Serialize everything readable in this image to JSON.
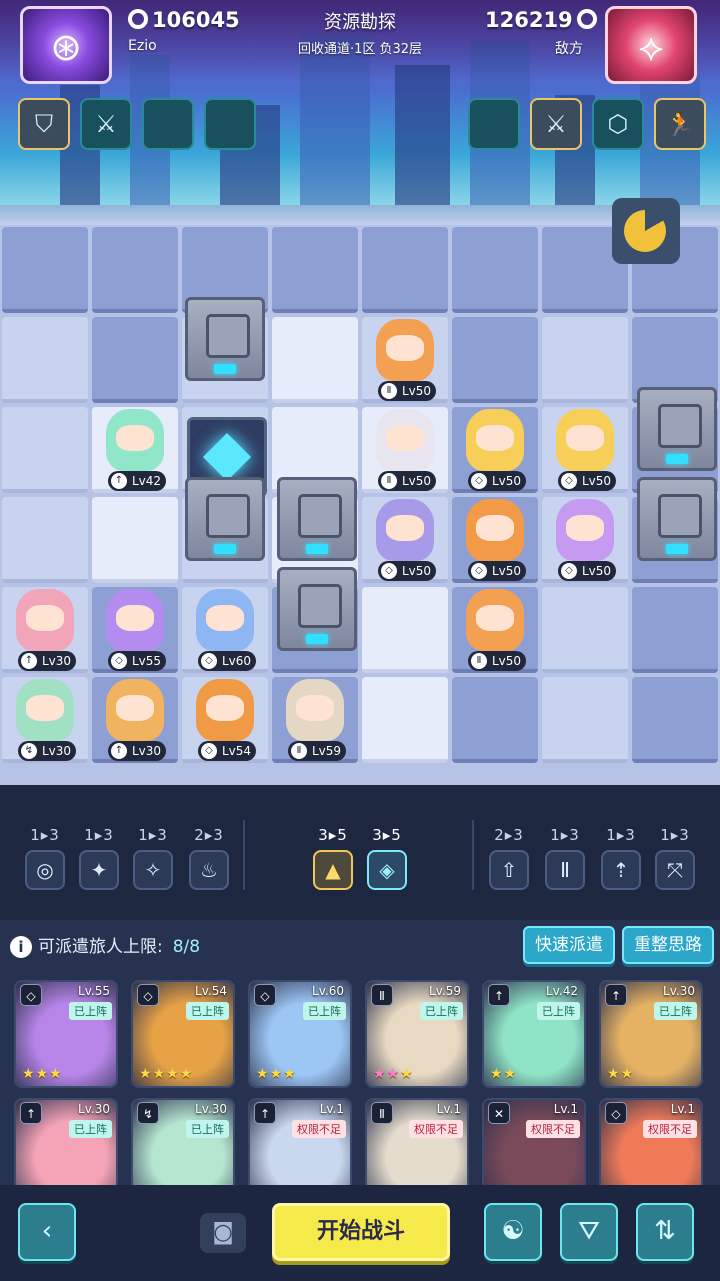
{
  "header": {
    "title": "资源勘探",
    "subtitle": "回收通道·1区 负32层",
    "player": {
      "name": "Ezio",
      "resource": "106045",
      "avatar_icon": "purple-emblem-icon"
    },
    "enemy": {
      "name": "敌方",
      "resource": "126219",
      "avatar_icon": "red-emblem-icon"
    },
    "player_slots": [
      "shield-emblem-icon",
      "sword-icon",
      "empty-slot",
      "empty-slot"
    ],
    "enemy_slots": [
      "empty-slot",
      "sword-icon",
      "hexagon-icon",
      "running-man-icon"
    ]
  },
  "board": {
    "units": [
      {
        "lv": "Lv42",
        "cls": "↑",
        "color": "#8fe6c9"
      },
      {
        "lv": "Lv30",
        "cls": "↑",
        "color": "#f2a4b8"
      },
      {
        "lv": "Lv55",
        "cls": "◇",
        "color": "#b48cf0"
      },
      {
        "lv": "Lv60",
        "cls": "◇",
        "color": "#8db6f3"
      },
      {
        "lv": "Lv30",
        "cls": "↯",
        "color": "#a2e0c4"
      },
      {
        "lv": "Lv30",
        "cls": "↑",
        "color": "#f2b361"
      },
      {
        "lv": "Lv54",
        "cls": "◇",
        "color": "#f09a45"
      },
      {
        "lv": "Lv59",
        "cls": "Ⅱ",
        "color": "#e4d7c4"
      },
      {
        "lv": "Lv50",
        "cls": "Ⅱ",
        "color": "#f3a053"
      },
      {
        "lv": "Lv50",
        "cls": "Ⅱ",
        "color": "#e8e4f0"
      },
      {
        "lv": "Lv50",
        "cls": "◇",
        "color": "#a79ae8"
      },
      {
        "lv": "Lv50",
        "cls": "◇",
        "color": "#f7cf58"
      },
      {
        "lv": "Lv50",
        "cls": "◇",
        "color": "#f7cf58"
      },
      {
        "lv": "Lv50",
        "cls": "◇",
        "color": "#f39a48"
      },
      {
        "lv": "Lv50",
        "cls": "◇",
        "color": "#c59af0"
      },
      {
        "lv": "Lv50",
        "cls": "Ⅱ",
        "color": "#f3a053"
      }
    ],
    "corner_icon": "pacman-icon"
  },
  "synergy": {
    "left": [
      {
        "count": "1▸3",
        "icon": "swirl-icon",
        "glyph": "◎"
      },
      {
        "count": "1▸3",
        "icon": "shuriken-icon",
        "glyph": "✦"
      },
      {
        "count": "1▸3",
        "icon": "dagger-icon",
        "glyph": "✧"
      },
      {
        "count": "2▸3",
        "icon": "flame-icon",
        "glyph": "♨"
      }
    ],
    "active": [
      {
        "count": "3▸5",
        "icon": "mountain-icon",
        "glyph": "▲"
      },
      {
        "count": "3▸5",
        "icon": "diamond-icon",
        "glyph": "◈"
      }
    ],
    "right": [
      {
        "count": "2▸3",
        "icon": "arrow-up-icon",
        "glyph": "⇧"
      },
      {
        "count": "1▸3",
        "icon": "gate-icon",
        "glyph": "Ⅱ"
      },
      {
        "count": "1▸3",
        "icon": "spear-icon",
        "glyph": "⇡"
      },
      {
        "count": "1▸3",
        "icon": "crossbow-icon",
        "glyph": "⤧"
      }
    ]
  },
  "roster": {
    "info_label": "可派遣旅人上限:",
    "info_value": "8/8",
    "quick_deploy": "快速派遣",
    "reset": "重整思路",
    "deployed_tag": "已上阵",
    "insufficient_tag": "权限不足",
    "cards": [
      {
        "lv": "Lv.55",
        "badge": "◇",
        "tag": "deployed",
        "stars": "★★★",
        "pink": 0,
        "color": "#b785e8"
      },
      {
        "lv": "Lv.54",
        "badge": "◇",
        "tag": "deployed",
        "stars": "★★★★",
        "pink": 0,
        "color": "#e7a246"
      },
      {
        "lv": "Lv.60",
        "badge": "◇",
        "tag": "deployed",
        "stars": "★★★",
        "pink": 0,
        "color": "#9cc6f4"
      },
      {
        "lv": "Lv.59",
        "badge": "Ⅱ",
        "tag": "deployed",
        "stars": "★★★",
        "pink": 1,
        "color": "#e8d9c2"
      },
      {
        "lv": "Lv.42",
        "badge": "↑",
        "tag": "deployed",
        "stars": "★★",
        "pink": 0,
        "color": "#8fe3c6"
      },
      {
        "lv": "Lv.30",
        "badge": "↑",
        "tag": "deployed",
        "stars": "★★",
        "pink": 0,
        "color": "#e5b264"
      },
      {
        "lv": "Lv.30",
        "badge": "↑",
        "tag": "deployed",
        "stars": "",
        "pink": 0,
        "color": "#f5a3b6"
      },
      {
        "lv": "Lv.30",
        "badge": "↯",
        "tag": "deployed",
        "stars": "",
        "pink": 0,
        "color": "#b5e6d0"
      },
      {
        "lv": "Lv.1",
        "badge": "↑",
        "tag": "insufficient",
        "stars": "",
        "pink": 0,
        "color": "#c9d8ee"
      },
      {
        "lv": "Lv.1",
        "badge": "Ⅱ",
        "tag": "insufficient",
        "stars": "",
        "pink": 0,
        "color": "#e4dccc"
      },
      {
        "lv": "Lv.1",
        "badge": "✕",
        "tag": "insufficient",
        "stars": "",
        "pink": 0,
        "color": "#7a4a5a"
      },
      {
        "lv": "Lv.1",
        "badge": "◇",
        "tag": "insufficient",
        "stars": "",
        "pink": 0,
        "color": "#f07a58"
      }
    ]
  },
  "bottom": {
    "back_icon": "chevron-left-icon",
    "camera_icon": "camera-icon",
    "start_label": "开始战斗",
    "brain_icon": "brain-icon",
    "filter_icon": "filter-icon",
    "sort_icon": "sort-icon"
  }
}
